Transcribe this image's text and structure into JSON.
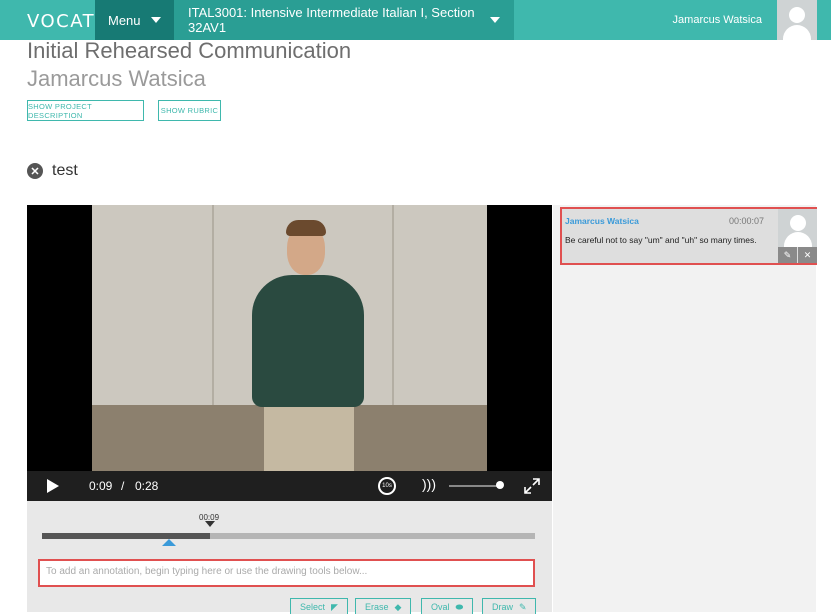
{
  "nav": {
    "logo": "VOCAT",
    "menu_label": "Menu",
    "course_label": "ITAL3001: Intensive Intermediate Italian I, Section 32AV1",
    "user_name": "Jamarcus Watsica",
    "brand_color": "#3fb8ad"
  },
  "project": {
    "title": "Initial Rehearsed Communication",
    "student": "Jamarcus Watsica",
    "show_description_label": "SHOW PROJECT DESCRIPTION",
    "show_rubric_label": "SHOW RUBRIC"
  },
  "clip": {
    "name": "test",
    "remove_icon": "close-circle-icon"
  },
  "player": {
    "current_time": "0:09",
    "separator": "/",
    "duration": "0:28",
    "rewind_label": "10s",
    "play_icon": "play-icon",
    "volume_icon": "volume-icon",
    "fullscreen_icon": "fullscreen-icon",
    "volume_level": 0.9
  },
  "annotator": {
    "marker_time": "00:09",
    "progress_fraction": 0.34,
    "input_placeholder": "To add an annotation, begin typing here or use the drawing tools below...",
    "tools": [
      {
        "label": "Select",
        "icon": "cursor-icon"
      },
      {
        "label": "Erase",
        "icon": "eraser-icon"
      },
      {
        "label": "Oval",
        "icon": "oval-icon"
      },
      {
        "label": "Draw",
        "icon": "pencil-icon"
      }
    ]
  },
  "annotations": [
    {
      "author": "Jamarcus Watsica",
      "timestamp": "00:00:07",
      "text": "Be careful not to say \"um\" and \"uh\" so many times."
    }
  ]
}
